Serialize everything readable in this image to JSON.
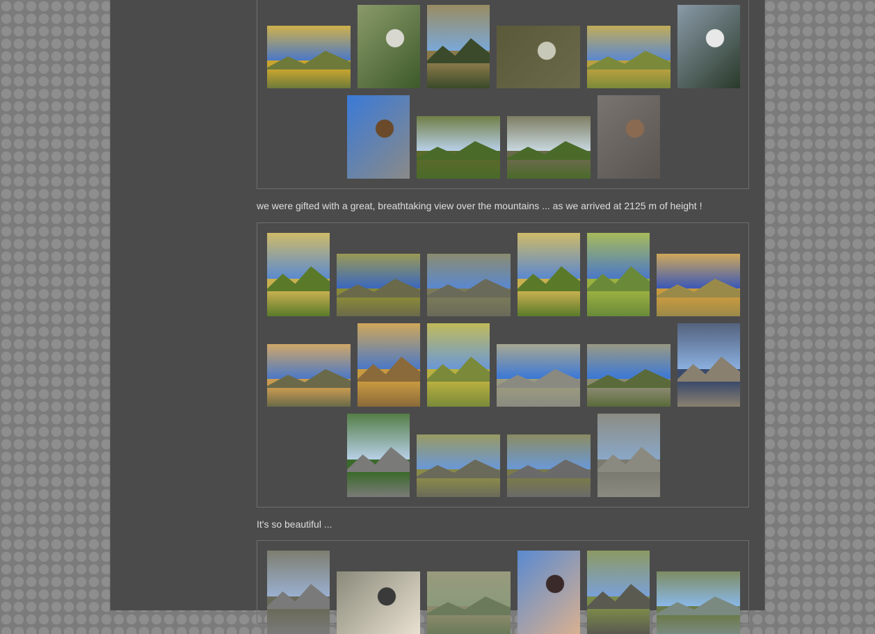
{
  "captions": {
    "first": "we were gifted with a great, breathtaking view over the mountains ... as we arrived at 2125 m of height !",
    "second": "It's so beautiful ..."
  },
  "palette": {
    "page_bg": "#4b4b4b",
    "outer_bg": "#7b7b7b",
    "border": "#6e6e6e",
    "text": "#dedede"
  },
  "photos": {
    "g1": [
      {
        "kind": "landscape",
        "sky": "#4a78c8",
        "mtn": "#6e7a3a",
        "grd": "#c8a530"
      },
      {
        "kind": "closeup",
        "c1": "#8a9a6a",
        "c2": "#3e5a2a",
        "c3": "#d8d8d0"
      },
      {
        "kind": "landscape",
        "sky": "#7aa8d8",
        "mtn": "#3a4a2a",
        "grd": "#8a7a4a"
      },
      {
        "kind": "closeup",
        "c1": "#5a5a3a",
        "c2": "#6a6a4a",
        "c3": "#c8c8b8"
      },
      {
        "kind": "landscape",
        "sky": "#5a88d0",
        "mtn": "#7a8a3a",
        "grd": "#b8a040"
      },
      {
        "kind": "closeup",
        "c1": "#8a9aa8",
        "c2": "#2a3a2a",
        "c3": "#e8e8e8"
      },
      {
        "kind": "closeup",
        "c1": "#3a7ad8",
        "c2": "#8a8a88",
        "c3": "#6a4a2a"
      },
      {
        "kind": "landscape",
        "sky": "#b8d0e8",
        "mtn": "#4a6a2a",
        "grd": "#5a6a2a"
      },
      {
        "kind": "landscape",
        "sky": "#c8d8e0",
        "mtn": "#4a6a2a",
        "grd": "#6a6a4a"
      },
      {
        "kind": "closeup",
        "c1": "#7a7470",
        "c2": "#5a5450",
        "c3": "#8a6a50"
      }
    ],
    "g2": [
      {
        "kind": "landscape",
        "sky": "#5a8ad0",
        "mtn": "#5a7a2a",
        "grd": "#c8b050"
      },
      {
        "kind": "landscape",
        "sky": "#3a68c0",
        "mtn": "#6a6a4a",
        "grd": "#8a8a3a"
      },
      {
        "kind": "landscape",
        "sky": "#5a88d0",
        "mtn": "#6a6a5a",
        "grd": "#7a7a5a"
      },
      {
        "kind": "landscape",
        "sky": "#5a88d0",
        "mtn": "#5a7a2a",
        "grd": "#c8b050"
      },
      {
        "kind": "landscape",
        "sky": "#4a78c8",
        "mtn": "#6a8a3a",
        "grd": "#9ab040"
      },
      {
        "kind": "landscape",
        "sky": "#3a58b8",
        "mtn": "#9a8a4a",
        "grd": "#c89a40"
      },
      {
        "kind": "landscape",
        "sky": "#4a78c8",
        "mtn": "#6a6a4a",
        "grd": "#c89a50"
      },
      {
        "kind": "landscape",
        "sky": "#4a78c8",
        "mtn": "#8a6a3a",
        "grd": "#c89a40"
      },
      {
        "kind": "landscape",
        "sky": "#6a98d8",
        "mtn": "#7a8a3a",
        "grd": "#b8b040"
      },
      {
        "kind": "landscape",
        "sky": "#3a78d8",
        "mtn": "#8a8a80",
        "grd": "#9a9a80"
      },
      {
        "kind": "landscape",
        "sky": "#3a78d8",
        "mtn": "#5a6a3a",
        "grd": "#8a8a70"
      },
      {
        "kind": "landscape",
        "sky": "#8ab0e0",
        "mtn": "#8a8070",
        "grd": "#3a4a6a"
      },
      {
        "kind": "landscape",
        "sky": "#b8d0e8",
        "mtn": "#7a7a78",
        "grd": "#3a6a2a"
      },
      {
        "kind": "landscape",
        "sky": "#6a98d8",
        "mtn": "#6a6a5a",
        "grd": "#8a8a4a"
      },
      {
        "kind": "landscape",
        "sky": "#6a98d8",
        "mtn": "#6a6a6a",
        "grd": "#7a7a4a"
      },
      {
        "kind": "landscape",
        "sky": "#8aa8c8",
        "mtn": "#8a8a80",
        "grd": "#7a7a70"
      }
    ],
    "g3": [
      {
        "kind": "landscape",
        "sky": "#9ab0d0",
        "mtn": "#7a7a7a",
        "grd": "#6a6a5a"
      },
      {
        "kind": "closeup",
        "c1": "#8a8a7a",
        "c2": "#e8e0d0",
        "c3": "#3a3a3a"
      },
      {
        "kind": "landscape",
        "sky": "#8a9a7a",
        "mtn": "#6a7a5a",
        "grd": "#8a8a6a"
      },
      {
        "kind": "closeup",
        "c1": "#5a8ad0",
        "c2": "#d8b090",
        "c3": "#3a2a2a"
      },
      {
        "kind": "landscape",
        "sky": "#7aa0d8",
        "mtn": "#5a5a50",
        "grd": "#7a8a4a"
      },
      {
        "kind": "landscape",
        "sky": "#8ab8e8",
        "mtn": "#7a8a80",
        "grd": "#6a7a4a"
      }
    ]
  }
}
